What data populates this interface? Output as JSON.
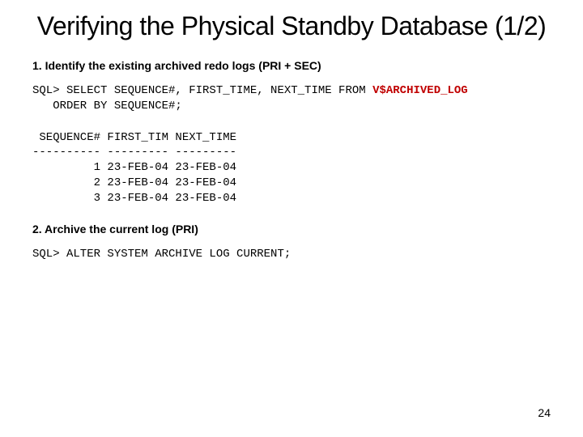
{
  "title": "Verifying the Physical Standby Database (1/2)",
  "step1": "1. Identify the existing archived redo logs (PRI + SEC)",
  "sql1_pre": "SQL> SELECT SEQUENCE#, FIRST_TIME, NEXT_TIME FROM ",
  "sql1_table": "V$ARCHIVED_LOG",
  "sql1_post": "   ORDER BY SEQUENCE#;",
  "result_header": " SEQUENCE# FIRST_TIM NEXT_TIME",
  "result_divider": "---------- --------- ---------",
  "result_row1": "         1 23-FEB-04 23-FEB-04",
  "result_row2": "         2 23-FEB-04 23-FEB-04",
  "result_row3": "         3 23-FEB-04 23-FEB-04",
  "step2": "2. Archive the current log (PRI)",
  "sql2": "SQL> ALTER SYSTEM ARCHIVE LOG CURRENT;",
  "page_number": "24"
}
